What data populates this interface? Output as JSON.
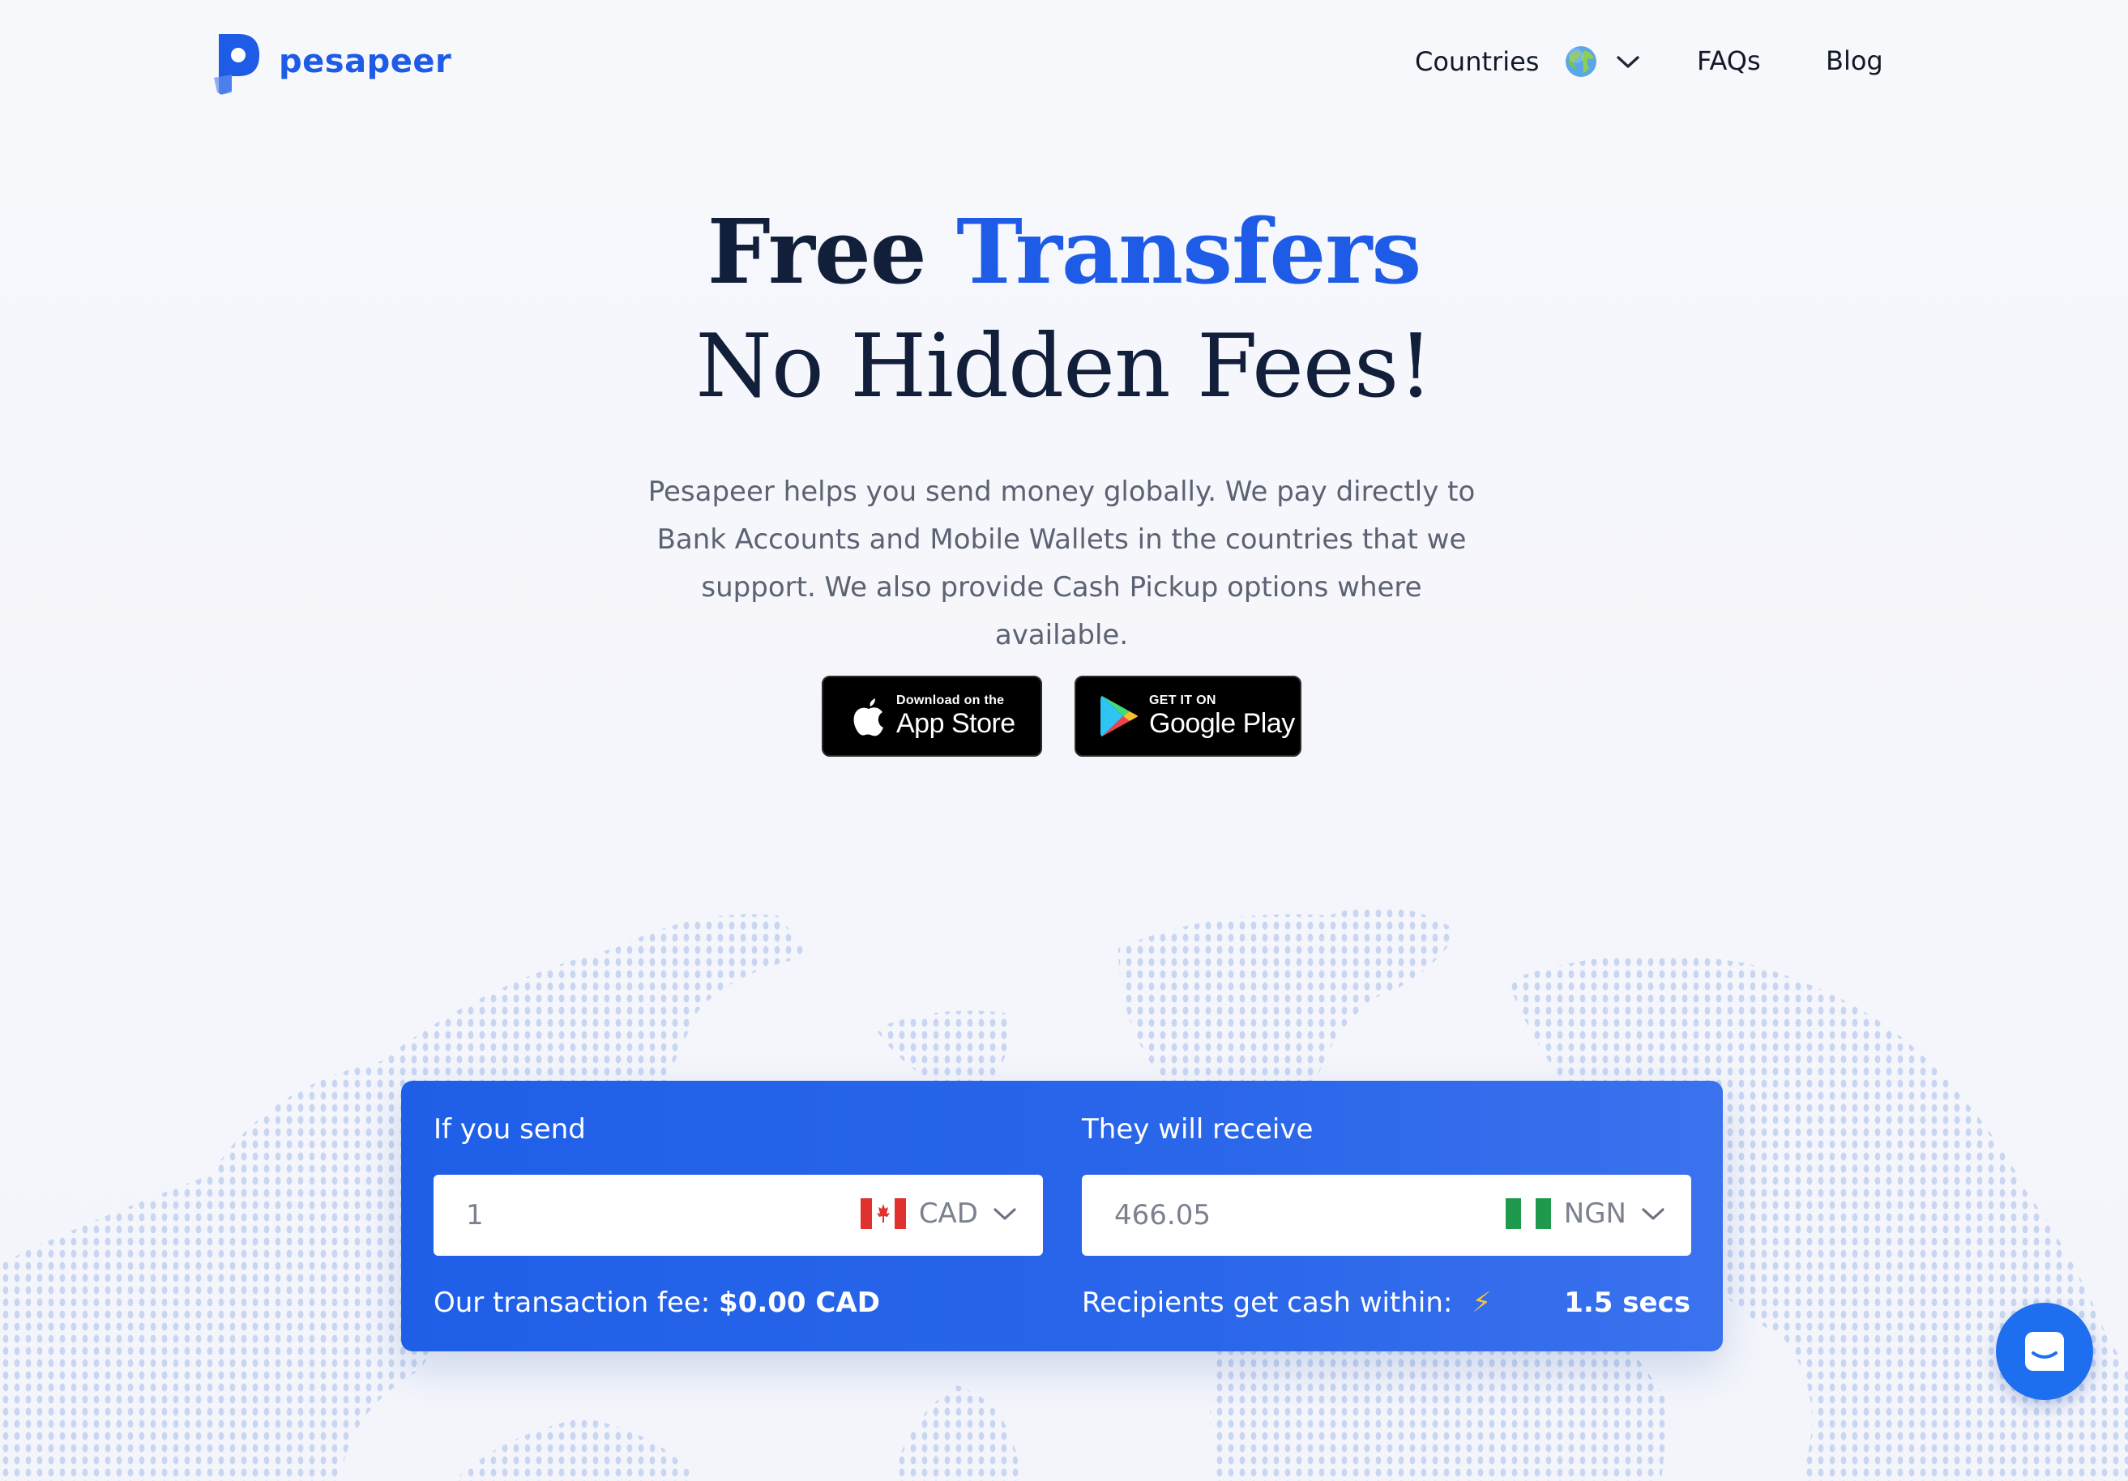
{
  "nav": {
    "brand": "pesapeer",
    "countries_label": "Countries",
    "faqs_label": "FAQs",
    "blog_label": "Blog"
  },
  "hero": {
    "title_part1": "Free",
    "title_part2": "Transfers",
    "subtitle": "No Hidden Fees!",
    "description": "Pesapeer helps you send money globally. We pay directly to Bank Accounts and Mobile Wallets in the countries that we support. We also provide Cash Pickup options where available."
  },
  "store_buttons": {
    "appstore_small": "Download on the",
    "appstore_big": "App Store",
    "googleplay_small": "GET IT ON",
    "googleplay_big": "Google Play"
  },
  "calculator": {
    "send_label": "If you send",
    "send_amount": "1",
    "send_currency": "CAD",
    "receive_label": "They will receive",
    "receive_amount": "466.05",
    "receive_currency": "NGN",
    "fee_label": "Our transaction fee:",
    "fee_value": "$0.00 CAD",
    "within_label": "Recipients get cash within:",
    "within_value": "1.5 secs"
  },
  "colors": {
    "brand_blue": "#1e5be6",
    "heading_navy": "#111f3a",
    "calculator_blue": "#2563eb",
    "bolt_yellow": "#f5c33b"
  }
}
